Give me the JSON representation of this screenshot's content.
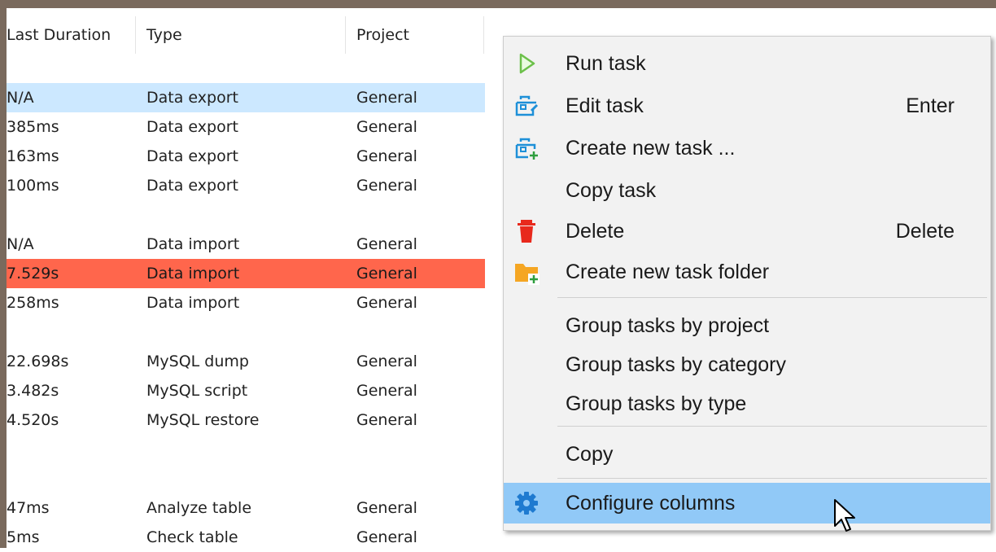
{
  "columns": {
    "last_duration": "Last Duration",
    "type": "Type",
    "project": "Project"
  },
  "rows": [
    {
      "duration": "N/A",
      "type": "Data export",
      "project": "General"
    },
    {
      "duration": "385ms",
      "type": "Data export",
      "project": "General"
    },
    {
      "duration": "163ms",
      "type": "Data export",
      "project": "General"
    },
    {
      "duration": "100ms",
      "type": "Data export",
      "project": "General"
    },
    {
      "duration": "N/A",
      "type": "Data import",
      "project": "General"
    },
    {
      "duration": "7.529s",
      "type": "Data import",
      "project": "General"
    },
    {
      "duration": "258ms",
      "type": "Data import",
      "project": "General"
    },
    {
      "duration": "22.698s",
      "type": "MySQL dump",
      "project": "General"
    },
    {
      "duration": "3.482s",
      "type": "MySQL script",
      "project": "General"
    },
    {
      "duration": "4.520s",
      "type": "MySQL restore",
      "project": "General"
    },
    {
      "duration": "47ms",
      "type": "Analyze table",
      "project": "General"
    },
    {
      "duration": "5ms",
      "type": "Check table",
      "project": "General"
    }
  ],
  "menu": {
    "run_task": {
      "label": "Run task",
      "icon": "play-icon"
    },
    "edit_task": {
      "label": "Edit task",
      "shortcut": "Enter",
      "icon": "edit-task-icon"
    },
    "create_task": {
      "label": "Create new task ...",
      "icon": "new-task-icon"
    },
    "copy_task": {
      "label": "Copy task"
    },
    "delete": {
      "label": "Delete",
      "shortcut": "Delete",
      "icon": "trash-icon"
    },
    "create_folder": {
      "label": "Create new task folder",
      "icon": "new-folder-icon"
    },
    "group_project": {
      "label": "Group tasks by project"
    },
    "group_category": {
      "label": "Group tasks by category"
    },
    "group_type": {
      "label": "Group tasks by type"
    },
    "copy": {
      "label": "Copy"
    },
    "configure_columns": {
      "label": "Configure columns",
      "icon": "gear-icon"
    }
  },
  "colors": {
    "selected_row": "#cce8ff",
    "error_row": "#ff664c",
    "menu_highlight": "#91c9f7",
    "icon_blue": "#1e90d8",
    "play_green": "#6cc04a",
    "delete_red": "#e8291c",
    "folder_orange": "#f5a623"
  }
}
